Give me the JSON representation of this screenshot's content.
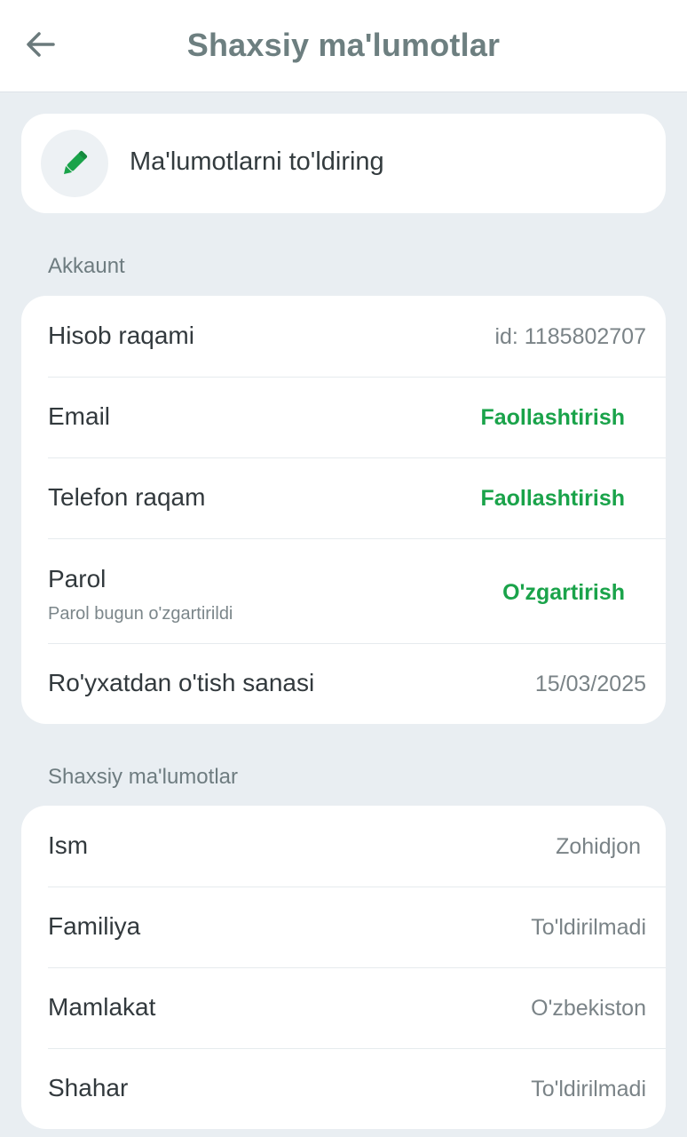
{
  "header": {
    "title": "Shaxsiy ma'lumotlar",
    "back_icon": "arrow-left-icon"
  },
  "fill_card": {
    "label": "Ma'lumotlarni to'ldiring",
    "icon": "pencil-icon"
  },
  "account": {
    "section_label": "Akkaunt",
    "rows": [
      {
        "label": "Hisob raqami",
        "value": "id: 1185802707"
      },
      {
        "label": "Email",
        "action": "Faollashtirish"
      },
      {
        "label": "Telefon raqam",
        "action": "Faollashtirish"
      },
      {
        "label": "Parol",
        "sub": "Parol bugun o'zgartirildi",
        "action": "O'zgartirish"
      },
      {
        "label": "Ro'yxatdan o'tish sanasi",
        "value": "15/03/2025"
      }
    ]
  },
  "personal": {
    "section_label": "Shaxsiy ma'lumotlar",
    "rows": [
      {
        "label": "Ism",
        "value": "Zohidjon"
      },
      {
        "label": "Familiya",
        "value": "To'ldirilmadi"
      },
      {
        "label": "Mamlakat",
        "value": "O'zbekiston"
      },
      {
        "label": "Shahar",
        "value": "To'ldirilmadi"
      }
    ]
  },
  "colors": {
    "accent_green": "#1aa34a",
    "background": "#e9eef2",
    "card": "#ffffff"
  }
}
